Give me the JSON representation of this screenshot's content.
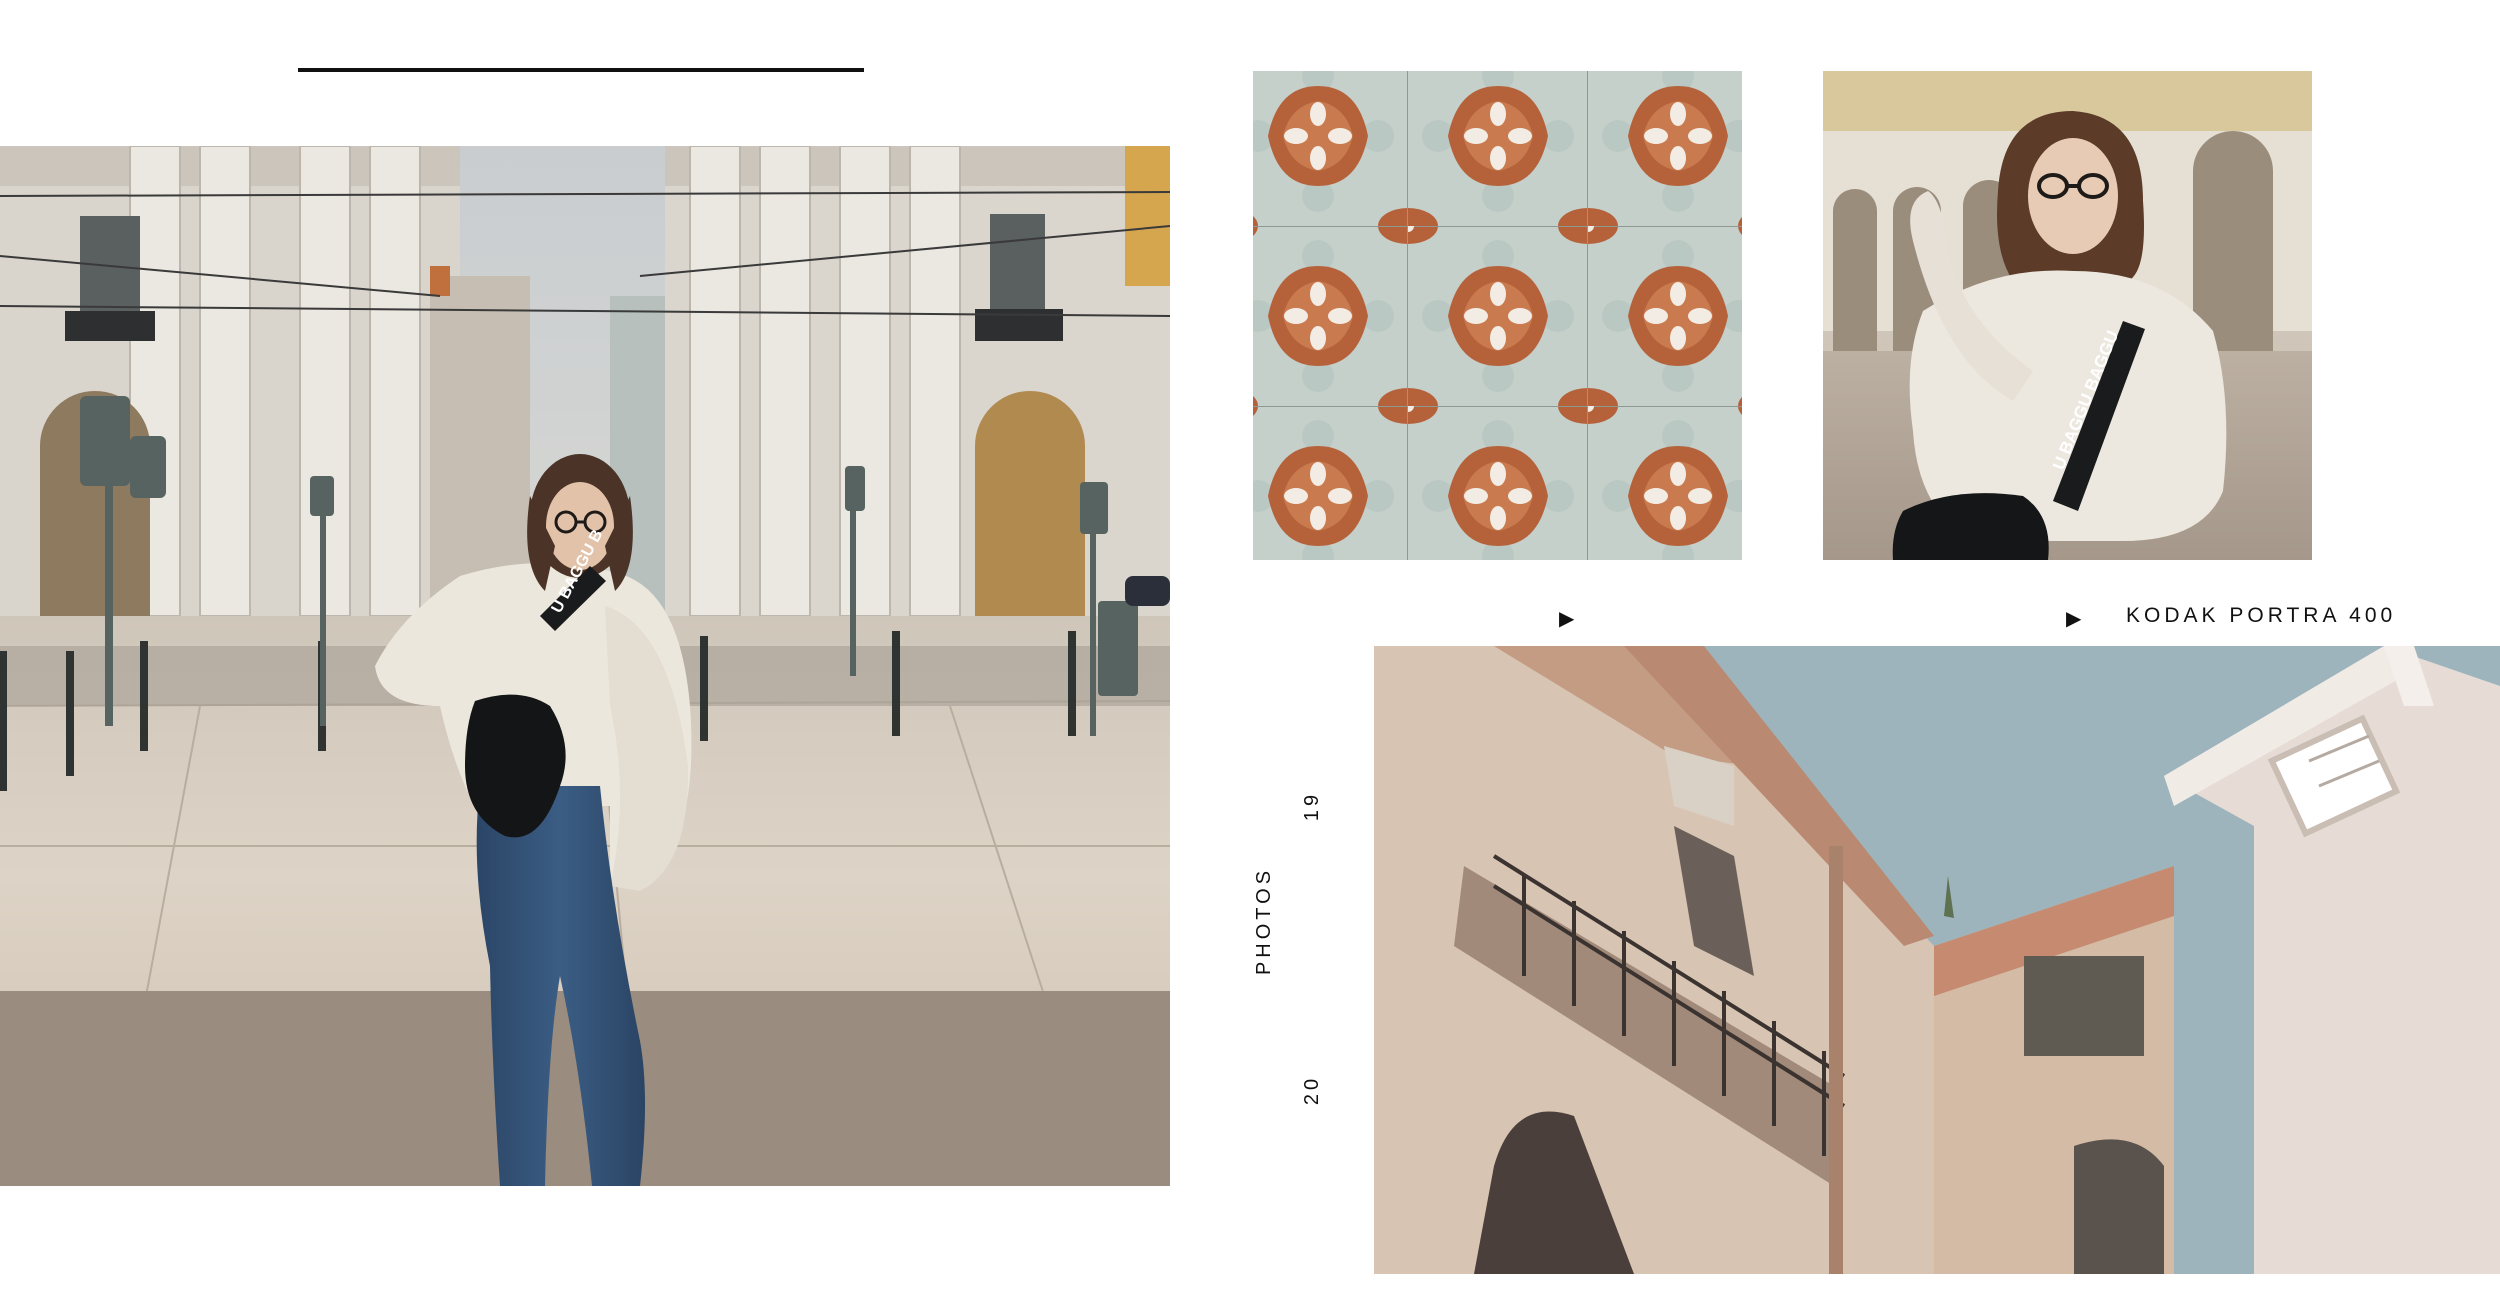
{
  "captions": {
    "arrow_1": "▶",
    "arrow_2": "▶",
    "film": "KODAK PORTRA 400",
    "year_top": "19",
    "photos": "PHOTOS",
    "year_bottom": "20"
  },
  "photos": [
    {
      "subject": "woman standing on wet stone plaza between colonnaded buildings"
    },
    {
      "subject": "orange and blue Portuguese azulejo tiles"
    },
    {
      "subject": "woman in cream sweater under arcade"
    },
    {
      "subject": "weathered building facade with balcony looking up to sky"
    }
  ],
  "bag_text": {
    "strap_1": "U BAGGU B",
    "strap_2": "U BAGGU BAGGU"
  }
}
